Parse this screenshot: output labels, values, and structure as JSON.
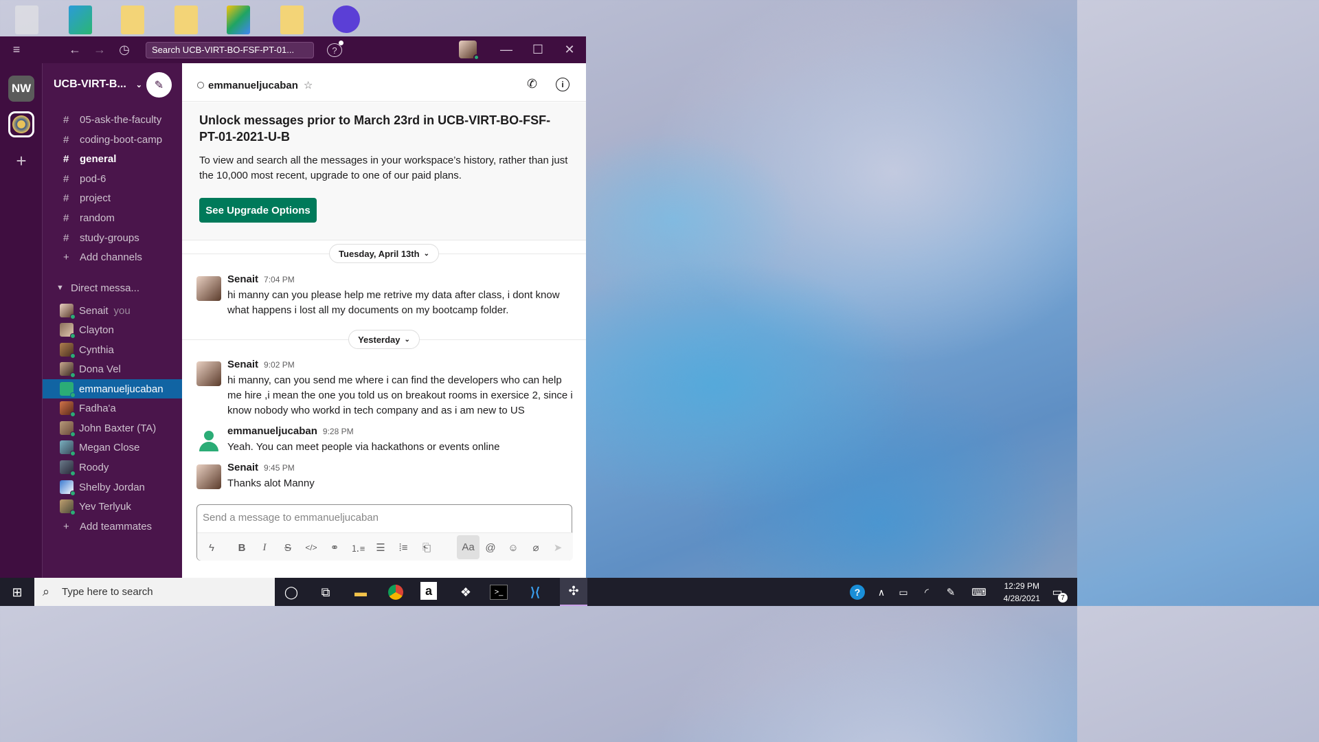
{
  "window": {
    "search_placeholder": "Search UCB-VIRT-BO-FSF-PT-01..."
  },
  "rail": {
    "workspace_initials": "NW"
  },
  "sidebar": {
    "workspace_name": "UCB-VIRT-B...",
    "channels": [
      "05-ask-the-faculty",
      "coding-boot-camp",
      "general",
      "pod-6",
      "project",
      "random",
      "study-groups"
    ],
    "add_channels": "Add channels",
    "dm_header": "Direct messa...",
    "dms": [
      {
        "name": "Senait",
        "suffix": "you"
      },
      {
        "name": "Clayton",
        "suffix": ""
      },
      {
        "name": "Cynthia",
        "suffix": ""
      },
      {
        "name": "Dona Vel",
        "suffix": ""
      },
      {
        "name": "emmanueljucaban",
        "suffix": ""
      },
      {
        "name": "Fadha'a",
        "suffix": ""
      },
      {
        "name": "John Baxter (TA)",
        "suffix": ""
      },
      {
        "name": "Megan Close",
        "suffix": ""
      },
      {
        "name": "Roody",
        "suffix": ""
      },
      {
        "name": "Shelby Jordan",
        "suffix": ""
      },
      {
        "name": "Yev Terlyuk",
        "suffix": ""
      }
    ],
    "add_teammates": "Add teammates"
  },
  "channel": {
    "name": "emmanueljucaban"
  },
  "banner": {
    "title": "Unlock messages prior to March 23rd in UCB-VIRT-BO-FSF-PT-01-2021-U-B",
    "body": "To view and search all the messages in your workspace’s history, rather than just the 10,000 most recent, upgrade to one of our paid plans.",
    "button": "See Upgrade Options"
  },
  "dates": [
    "Tuesday, April 13th",
    "Yesterday"
  ],
  "messages": [
    {
      "author": "Senait",
      "time": "7:04 PM",
      "text": "hi manny can you please help me retrive my data after class, i dont know what happens i lost all my documents on my bootcamp folder."
    },
    {
      "author": "Senait",
      "time": "9:02 PM",
      "text": "hi manny, can you send me  where i can find the developers who can help me hire ,i mean the one you told us on breakout rooms in exersice 2, since i know nobody who workd in tech company and as i am new to US"
    },
    {
      "author": "emmanueljucaban",
      "time": "9:28 PM",
      "text": "Yeah. You can meet people via hackathons or events online"
    },
    {
      "author": "Senait",
      "time": "9:45 PM",
      "text": "Thanks alot Manny"
    }
  ],
  "composer": {
    "placeholder": "Send a message to emmanueljucaban",
    "format_label": "Aa"
  },
  "taskbar": {
    "search_placeholder": "Type here to search",
    "time": "12:29 PM",
    "date": "4/28/2021",
    "notif_count": "7"
  },
  "colors": {
    "sidebar": "#4a154b",
    "rail": "#3f0e40",
    "selected": "#1164a3",
    "upgrade_button": "#007a5a"
  }
}
